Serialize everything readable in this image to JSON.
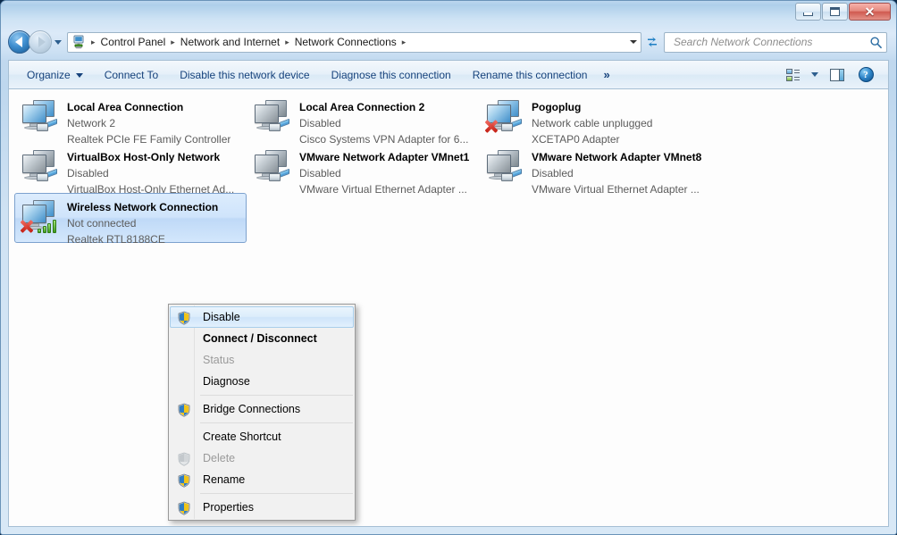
{
  "window": {
    "minimize_label": "Minimize",
    "maximize_label": "Maximize",
    "close_label": "Close"
  },
  "addressbar": {
    "back_label": "Back",
    "forward_label": "Forward",
    "history_label": "Recent pages",
    "icon": "control-panel-network-icon",
    "breadcrumbs": [
      "Control Panel",
      "Network and Internet",
      "Network Connections"
    ],
    "separator": "▸",
    "refresh_label": "Refresh",
    "dropdown_label": "Previous locations"
  },
  "search": {
    "placeholder": "Search Network Connections",
    "value": "",
    "icon": "search-icon"
  },
  "commandbar": {
    "items": [
      {
        "label": "Organize",
        "has_caret": true
      },
      {
        "label": "Connect To",
        "has_caret": false
      },
      {
        "label": "Disable this network device",
        "has_caret": false
      },
      {
        "label": "Diagnose this connection",
        "has_caret": false
      },
      {
        "label": "Rename this connection",
        "has_caret": false
      }
    ],
    "overflow": "»",
    "view_label": "Change your view",
    "preview_label": "Show the preview pane",
    "help_label": "Get help",
    "help_glyph": "?"
  },
  "connections": [
    {
      "name": "Local Area Connection",
      "status": "Network  2",
      "device": "Realtek PCIe FE Family Controller",
      "icon": "network-adapter-icon",
      "badge": "rj45-plug",
      "disabled": false,
      "error": false,
      "selected": false
    },
    {
      "name": "Local Area Connection 2",
      "status": "Disabled",
      "device": "Cisco Systems VPN Adapter for 6...",
      "icon": "network-adapter-icon",
      "badge": "rj45-plug",
      "disabled": true,
      "error": false,
      "selected": false
    },
    {
      "name": "Pogoplug",
      "status": "Network cable unplugged",
      "device": "XCETAP0 Adapter",
      "icon": "network-adapter-icon",
      "badge": "rj45-plug",
      "disabled": false,
      "error": true,
      "selected": false
    },
    {
      "name": "VirtualBox Host-Only Network",
      "status": "Disabled",
      "device": "VirtualBox Host-Only Ethernet Ad...",
      "icon": "network-adapter-icon",
      "badge": "rj45-plug",
      "disabled": true,
      "error": false,
      "selected": false
    },
    {
      "name": "VMware Network Adapter VMnet1",
      "status": "Disabled",
      "device": "VMware Virtual Ethernet Adapter ...",
      "icon": "network-adapter-icon",
      "badge": "rj45-plug",
      "disabled": true,
      "error": false,
      "selected": false
    },
    {
      "name": "VMware Network Adapter VMnet8",
      "status": "Disabled",
      "device": "VMware Virtual Ethernet Adapter ...",
      "icon": "network-adapter-icon",
      "badge": "rj45-plug",
      "disabled": true,
      "error": false,
      "selected": false
    },
    {
      "name": "Wireless Network Connection",
      "status": "Not connected",
      "device": "Realtek RTL8188CE",
      "icon": "wireless-adapter-icon",
      "badge": "signal-bars",
      "disabled": false,
      "error": true,
      "selected": true
    }
  ],
  "context_menu": {
    "items": [
      {
        "label": "Disable",
        "shield": true,
        "shield_state": "enabled",
        "bold": false,
        "disabled": false,
        "hover": true,
        "separator_after": false
      },
      {
        "label": "Connect / Disconnect",
        "shield": false,
        "shield_state": "none",
        "bold": true,
        "disabled": false,
        "hover": false,
        "separator_after": false
      },
      {
        "label": "Status",
        "shield": false,
        "shield_state": "none",
        "bold": false,
        "disabled": true,
        "hover": false,
        "separator_after": false
      },
      {
        "label": "Diagnose",
        "shield": false,
        "shield_state": "none",
        "bold": false,
        "disabled": false,
        "hover": false,
        "separator_after": true
      },
      {
        "label": "Bridge Connections",
        "shield": true,
        "shield_state": "enabled",
        "bold": false,
        "disabled": false,
        "hover": false,
        "separator_after": true
      },
      {
        "label": "Create Shortcut",
        "shield": false,
        "shield_state": "none",
        "bold": false,
        "disabled": false,
        "hover": false,
        "separator_after": false
      },
      {
        "label": "Delete",
        "shield": true,
        "shield_state": "disabled",
        "bold": false,
        "disabled": true,
        "hover": false,
        "separator_after": false
      },
      {
        "label": "Rename",
        "shield": true,
        "shield_state": "enabled",
        "bold": false,
        "disabled": false,
        "hover": false,
        "separator_after": true
      },
      {
        "label": "Properties",
        "shield": true,
        "shield_state": "enabled",
        "bold": false,
        "disabled": false,
        "hover": false,
        "separator_after": false
      }
    ]
  },
  "colors": {
    "accent_blue": "#16427c",
    "selection_blue": "#cfe4fb",
    "selection_border": "#7da2ce",
    "frame_glass": "#cfe2f3",
    "content_bg": "#fdfdfd",
    "menu_bg": "#f1f1f1",
    "disabled_text": "#9a9a9a",
    "sub_text": "#5c5c5c",
    "close_red": "#d05a50"
  }
}
